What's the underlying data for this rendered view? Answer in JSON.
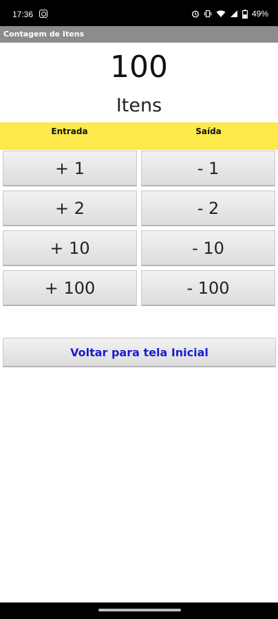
{
  "status_bar": {
    "time": "17:36",
    "battery": "49%",
    "icons": [
      "instagram-icon",
      "alarm-icon",
      "vibrate-icon",
      "wifi-icon",
      "signal-icon",
      "battery-icon"
    ]
  },
  "app": {
    "title": "Contagem de Itens"
  },
  "counter": {
    "value": "100",
    "unit": "Itens"
  },
  "columns": {
    "in_label": "Entrada",
    "out_label": "Saída"
  },
  "buttons": {
    "add_1": "+ 1",
    "add_2": "+ 2",
    "add_10": "+ 10",
    "add_100": "+ 100",
    "sub_1": "- 1",
    "sub_2": "- 2",
    "sub_10": "- 10",
    "sub_100": "- 100"
  },
  "back_button": "Voltar para tela Inicial",
  "colors": {
    "accent_band": "#fde94a",
    "back_text": "#1a1ad6",
    "title_bar": "#8c8c8c"
  }
}
